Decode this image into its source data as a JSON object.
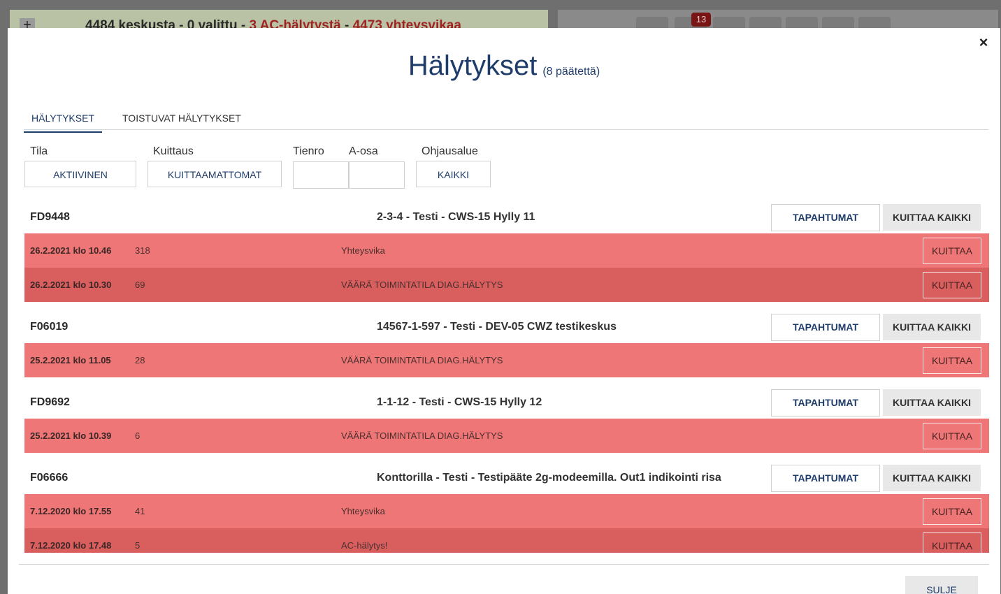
{
  "background": {
    "zoom_label": "+",
    "status_main": "4484 keskusta - 0 valittu - ",
    "status_ac": "3 AC-hälytystä",
    "status_sep": " - ",
    "status_conn": "4473 yhteysvikaa",
    "notification_count": "13"
  },
  "modal": {
    "close_symbol": "×",
    "title": "Hälytykset",
    "subtitle": "(8 päätettä)",
    "tabs": [
      {
        "label": "HÄLYTYKSET",
        "active": true
      },
      {
        "label": "TOISTUVAT HÄLYTYKSET",
        "active": false
      }
    ],
    "filters": {
      "tila_label": "Tila",
      "tila_value": "AKTIIVINEN",
      "kuittaus_label": "Kuittaus",
      "kuittaus_value": "KUITTAAMATTOMAT",
      "tienro_label": "Tienro",
      "tienro_value": "",
      "aosa_label": "A-osa",
      "aosa_value": "",
      "ohjausalue_label": "Ohjausalue",
      "ohjausalue_value": "KAIKKI"
    },
    "events_label": "TAPAHTUMAT",
    "ack_all_label": "KUITTAA KAIKKI",
    "ack_label": "KUITTAA",
    "groups": [
      {
        "id": "FD9448",
        "name": "2-3-4 - Testi - CWS-15 Hylly 11",
        "alarms": [
          {
            "date": "26.2.2021 klo 10.46",
            "count": "318",
            "desc": "Yhteysvika",
            "shade": "light"
          },
          {
            "date": "26.2.2021 klo 10.30",
            "count": "69",
            "desc": "VÄÄRÄ TOIMINTATILA DIAG.HÄLYTYS",
            "shade": "dark"
          }
        ]
      },
      {
        "id": "F06019",
        "name": "14567-1-597 - Testi - DEV-05 CWZ testikeskus",
        "alarms": [
          {
            "date": "25.2.2021 klo 11.05",
            "count": "28",
            "desc": "VÄÄRÄ TOIMINTATILA DIAG.HÄLYTYS",
            "shade": "light"
          }
        ]
      },
      {
        "id": "FD9692",
        "name": "1-1-12 - Testi - CWS-15 Hylly 12",
        "alarms": [
          {
            "date": "25.2.2021 klo 10.39",
            "count": "6",
            "desc": "VÄÄRÄ TOIMINTATILA DIAG.HÄLYTYS",
            "shade": "light"
          }
        ]
      },
      {
        "id": "F06666",
        "name": "Konttorilla - Testi - Testipääte 2g-modeemilla. Out1 indikointi risa",
        "alarms": [
          {
            "date": "7.12.2020 klo 17.55",
            "count": "41",
            "desc": "Yhteysvika",
            "shade": "light"
          },
          {
            "date": "7.12.2020 klo 17.48",
            "count": "5",
            "desc": "AC-hälytys!",
            "shade": "dark"
          }
        ]
      }
    ],
    "footer_close_label": "SULJE"
  }
}
